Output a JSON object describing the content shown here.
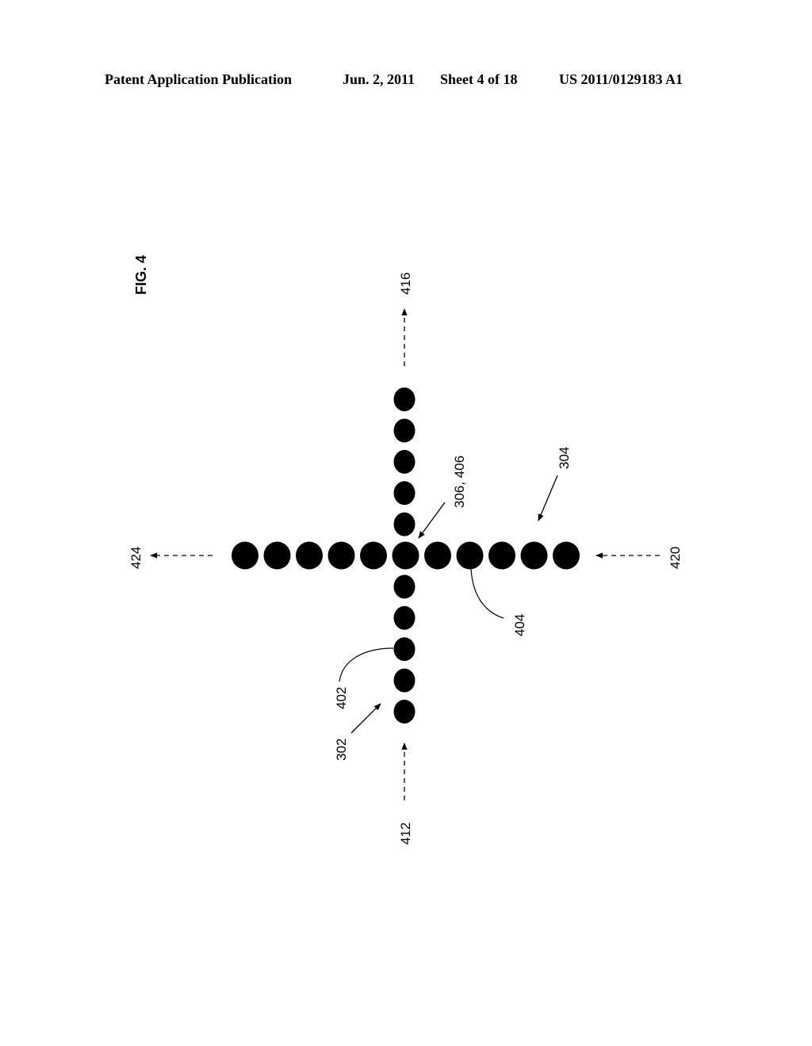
{
  "header": {
    "publication": "Patent Application Publication",
    "date": "Jun. 2, 2011",
    "sheet": "Sheet 4 of 18",
    "number": "US 2011/0129183 A1"
  },
  "figure": {
    "title": "FIG. 4",
    "vertical_dot_count": 11,
    "horizontal_dot_count": 11,
    "labels": {
      "top_arrow": "416",
      "bottom_arrow": "412",
      "left_arrow": "424",
      "right_arrow": "420",
      "intersection": "306, 406",
      "horizontal_row": "304",
      "horizontal_dot": "404",
      "vertical_column": "302",
      "vertical_dot": "402"
    }
  }
}
